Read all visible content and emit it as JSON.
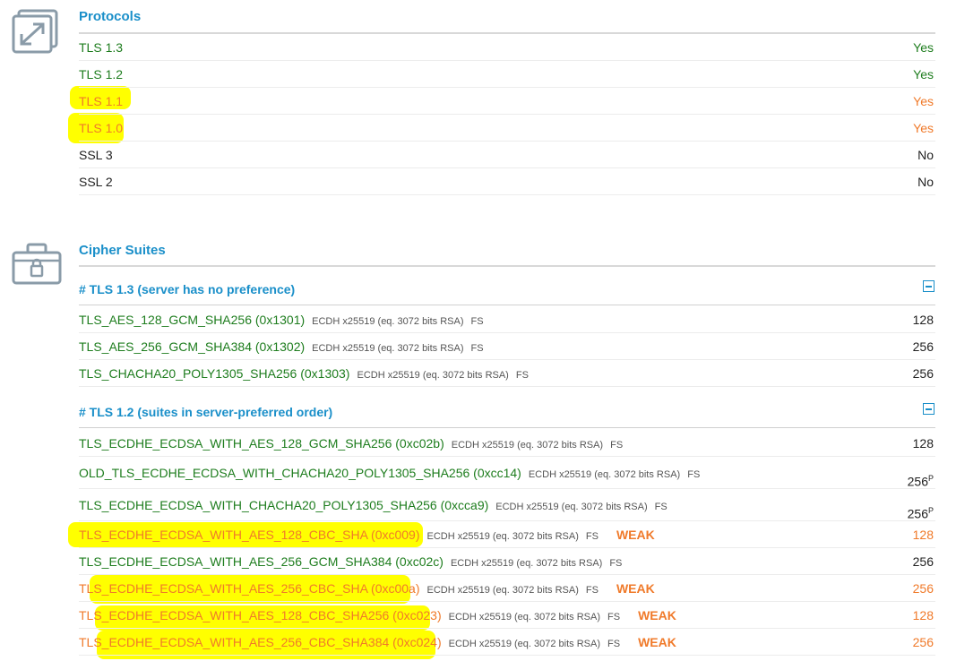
{
  "protocols": {
    "title": "Protocols",
    "rows": [
      {
        "name": "TLS 1.3",
        "value": "Yes",
        "status": "good"
      },
      {
        "name": "TLS 1.2",
        "value": "Yes",
        "status": "good"
      },
      {
        "name": "TLS 1.1",
        "value": "Yes",
        "status": "warn"
      },
      {
        "name": "TLS 1.0",
        "value": "Yes",
        "status": "warn"
      },
      {
        "name": "SSL 3",
        "value": "No",
        "status": "neutral"
      },
      {
        "name": "SSL 2",
        "value": "No",
        "status": "neutral"
      }
    ]
  },
  "ciphers": {
    "title": "Cipher Suites",
    "groups": [
      {
        "title": "# TLS 1.3 (server has no preference)",
        "suites": [
          {
            "name": "TLS_AES_128_GCM_SHA256",
            "code": "(0x1301)",
            "kex": "ECDH x25519 (eq. 3072 bits RSA)",
            "fs": "FS",
            "weak": "",
            "bits": "128",
            "sup": "",
            "status": "good"
          },
          {
            "name": "TLS_AES_256_GCM_SHA384",
            "code": "(0x1302)",
            "kex": "ECDH x25519 (eq. 3072 bits RSA)",
            "fs": "FS",
            "weak": "",
            "bits": "256",
            "sup": "",
            "status": "good"
          },
          {
            "name": "TLS_CHACHA20_POLY1305_SHA256",
            "code": "(0x1303)",
            "kex": "ECDH x25519 (eq. 3072 bits RSA)",
            "fs": "FS",
            "weak": "",
            "bits": "256",
            "sup": "",
            "status": "good"
          }
        ]
      },
      {
        "title": "# TLS 1.2 (suites in server-preferred order)",
        "suites": [
          {
            "name": "TLS_ECDHE_ECDSA_WITH_AES_128_GCM_SHA256",
            "code": "(0xc02b)",
            "kex": "ECDH x25519 (eq. 3072 bits RSA)",
            "fs": "FS",
            "weak": "",
            "bits": "128",
            "sup": "",
            "status": "good"
          },
          {
            "name": "OLD_TLS_ECDHE_ECDSA_WITH_CHACHA20_POLY1305_SHA256",
            "code": "(0xcc14)",
            "kex": "ECDH x25519 (eq. 3072 bits RSA)",
            "fs": "FS",
            "weak": "",
            "bits": "256",
            "sup": "P",
            "status": "good"
          },
          {
            "name": "TLS_ECDHE_ECDSA_WITH_CHACHA20_POLY1305_SHA256",
            "code": "(0xcca9)",
            "kex": "ECDH x25519 (eq. 3072 bits RSA)",
            "fs": "FS",
            "weak": "",
            "bits": "256",
            "sup": "P",
            "status": "good"
          },
          {
            "name": "TLS_ECDHE_ECDSA_WITH_AES_128_CBC_SHA",
            "code": "(0xc009)",
            "kex": "ECDH x25519 (eq. 3072 bits RSA)",
            "fs": "FS",
            "weak": "WEAK",
            "bits": "128",
            "sup": "",
            "status": "warn"
          },
          {
            "name": "TLS_ECDHE_ECDSA_WITH_AES_256_GCM_SHA384",
            "code": "(0xc02c)",
            "kex": "ECDH x25519 (eq. 3072 bits RSA)",
            "fs": "FS",
            "weak": "",
            "bits": "256",
            "sup": "",
            "status": "good"
          },
          {
            "name": "TLS_ECDHE_ECDSA_WITH_AES_256_CBC_SHA",
            "code": "(0xc00a)",
            "kex": "ECDH x25519 (eq. 3072 bits RSA)",
            "fs": "FS",
            "weak": "WEAK",
            "bits": "256",
            "sup": "",
            "status": "warn"
          },
          {
            "name": "TLS_ECDHE_ECDSA_WITH_AES_128_CBC_SHA256",
            "code": "(0xc023)",
            "kex": "ECDH x25519 (eq. 3072 bits RSA)",
            "fs": "FS",
            "weak": "WEAK",
            "bits": "128",
            "sup": "",
            "status": "warn"
          },
          {
            "name": "TLS_ECDHE_ECDSA_WITH_AES_256_CBC_SHA384",
            "code": "(0xc024)",
            "kex": "ECDH x25519 (eq. 3072 bits RSA)",
            "fs": "FS",
            "weak": "WEAK",
            "bits": "256",
            "sup": "",
            "status": "warn"
          }
        ]
      }
    ]
  },
  "colors": {
    "accent": "#1a8fc9",
    "good": "#1e7d1e",
    "warn": "#f07a2a",
    "highlight": "#ffff00"
  },
  "icons": {
    "protocols": "resize-arrows-icon",
    "ciphers": "briefcase-lock-icon",
    "collapse": "collapse-minus-icon"
  }
}
